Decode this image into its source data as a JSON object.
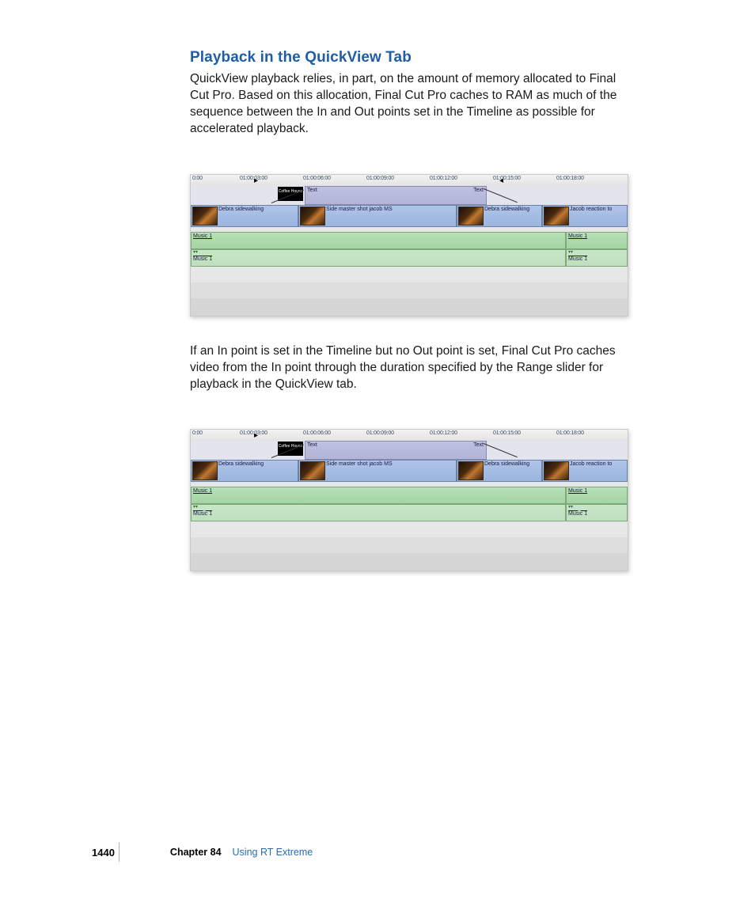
{
  "heading": "Playback in the QuickView Tab",
  "para1": "QuickView playback relies, in part, on the amount of memory allocated to Final Cut Pro. Based on this allocation, Final Cut Pro caches to RAM as much of the sequence between the In and Out points set in the Timeline as possible for accelerated playback.",
  "para2": "If an In point is set in the Timeline but no Out point is set, Final Cut Pro caches video from the In point through the duration specified by the Range slider for playback in the QuickView tab.",
  "ruler": {
    "t0": "0:00",
    "t1": "01:00:03:00",
    "t2": "01:00:06:00",
    "t3": "01:00:09:00",
    "t4": "01:00:12:00",
    "t5": "01:00:15:00",
    "t6": "01:00:18:00"
  },
  "clips": {
    "textLabel": "Text",
    "marker": "Coffee House",
    "v1": "Debra sidewalking",
    "v2": "Side master shot jacob MS",
    "v3": "Debra sidewalking",
    "v4": "Jacob reaction to",
    "a1": "Music 1",
    "a2": "Music 1"
  },
  "footer": {
    "page": "1440",
    "chapter": "Chapter 84",
    "title": "Using RT Extreme"
  }
}
